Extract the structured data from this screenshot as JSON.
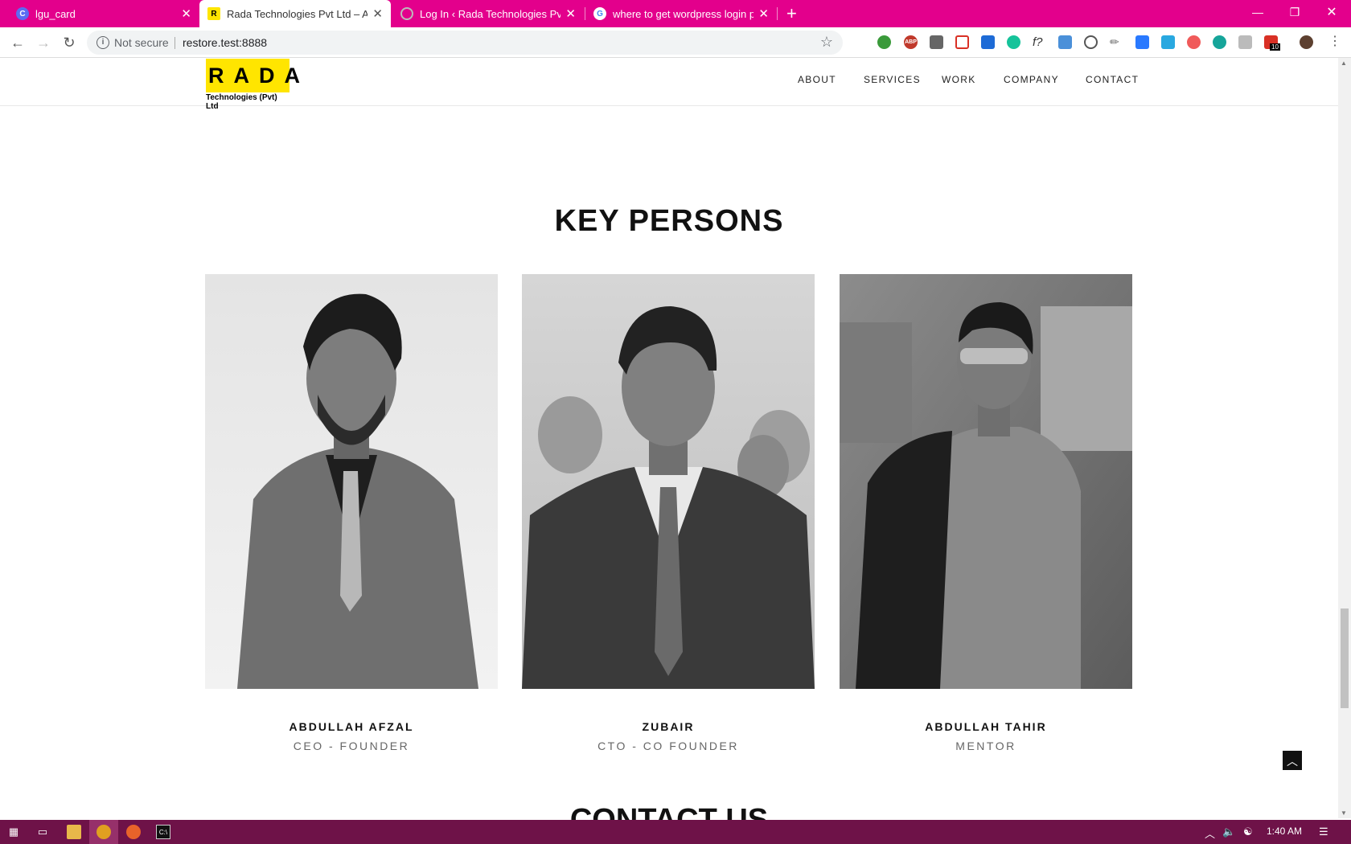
{
  "browser": {
    "tabs": [
      {
        "title": "lgu_card",
        "favicon": "C",
        "fav_color": "#5b6cf2"
      },
      {
        "title": "Rada Technologies Pvt Ltd – Auto",
        "favicon": "R",
        "fav_color": "#ffe500"
      },
      {
        "title": "Log In ‹ Rada Technologies Pvt Ltd",
        "favicon": "",
        "fav_color": "#888888"
      },
      {
        "title": "where to get wordpress login pa",
        "favicon": "G",
        "fav_color": "#ffffff"
      }
    ],
    "not_secure": "Not secure",
    "url": "restore.test:8888",
    "ext_badge": "10"
  },
  "site": {
    "logo_text": "RADA",
    "logo_sub": "Technologies (Pvt) Ltd",
    "nav": [
      "ABOUT",
      "SERVICES",
      "WORK",
      "COMPANY",
      "CONTACT"
    ],
    "section_title": "KEY PERSONS",
    "next_section_title": "CONTACT US",
    "persons": [
      {
        "name": "ABDULLAH AFZAL",
        "role": "CEO - FOUNDER"
      },
      {
        "name": "ZUBAIR",
        "role": "CTO - CO FOUNDER"
      },
      {
        "name": "ABDULLAH TAHIR",
        "role": "MENTOR"
      }
    ]
  },
  "taskbar": {
    "time": "1:40 AM"
  },
  "colors": {
    "tab_bar": "#e3008c",
    "logo_bg": "#ffe500",
    "taskbar": "#6e1248"
  }
}
